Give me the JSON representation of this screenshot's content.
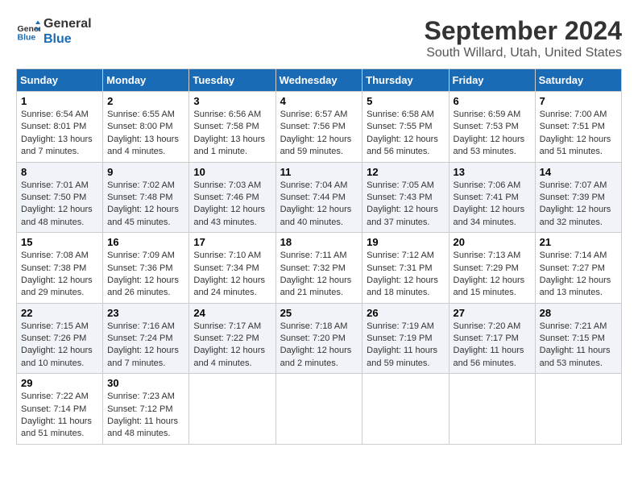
{
  "header": {
    "logo_line1": "General",
    "logo_line2": "Blue",
    "month": "September 2024",
    "location": "South Willard, Utah, United States"
  },
  "weekdays": [
    "Sunday",
    "Monday",
    "Tuesday",
    "Wednesday",
    "Thursday",
    "Friday",
    "Saturday"
  ],
  "weeks": [
    [
      {
        "day": "1",
        "info": "Sunrise: 6:54 AM\nSunset: 8:01 PM\nDaylight: 13 hours\nand 7 minutes."
      },
      {
        "day": "2",
        "info": "Sunrise: 6:55 AM\nSunset: 8:00 PM\nDaylight: 13 hours\nand 4 minutes."
      },
      {
        "day": "3",
        "info": "Sunrise: 6:56 AM\nSunset: 7:58 PM\nDaylight: 13 hours\nand 1 minute."
      },
      {
        "day": "4",
        "info": "Sunrise: 6:57 AM\nSunset: 7:56 PM\nDaylight: 12 hours\nand 59 minutes."
      },
      {
        "day": "5",
        "info": "Sunrise: 6:58 AM\nSunset: 7:55 PM\nDaylight: 12 hours\nand 56 minutes."
      },
      {
        "day": "6",
        "info": "Sunrise: 6:59 AM\nSunset: 7:53 PM\nDaylight: 12 hours\nand 53 minutes."
      },
      {
        "day": "7",
        "info": "Sunrise: 7:00 AM\nSunset: 7:51 PM\nDaylight: 12 hours\nand 51 minutes."
      }
    ],
    [
      {
        "day": "8",
        "info": "Sunrise: 7:01 AM\nSunset: 7:50 PM\nDaylight: 12 hours\nand 48 minutes."
      },
      {
        "day": "9",
        "info": "Sunrise: 7:02 AM\nSunset: 7:48 PM\nDaylight: 12 hours\nand 45 minutes."
      },
      {
        "day": "10",
        "info": "Sunrise: 7:03 AM\nSunset: 7:46 PM\nDaylight: 12 hours\nand 43 minutes."
      },
      {
        "day": "11",
        "info": "Sunrise: 7:04 AM\nSunset: 7:44 PM\nDaylight: 12 hours\nand 40 minutes."
      },
      {
        "day": "12",
        "info": "Sunrise: 7:05 AM\nSunset: 7:43 PM\nDaylight: 12 hours\nand 37 minutes."
      },
      {
        "day": "13",
        "info": "Sunrise: 7:06 AM\nSunset: 7:41 PM\nDaylight: 12 hours\nand 34 minutes."
      },
      {
        "day": "14",
        "info": "Sunrise: 7:07 AM\nSunset: 7:39 PM\nDaylight: 12 hours\nand 32 minutes."
      }
    ],
    [
      {
        "day": "15",
        "info": "Sunrise: 7:08 AM\nSunset: 7:38 PM\nDaylight: 12 hours\nand 29 minutes."
      },
      {
        "day": "16",
        "info": "Sunrise: 7:09 AM\nSunset: 7:36 PM\nDaylight: 12 hours\nand 26 minutes."
      },
      {
        "day": "17",
        "info": "Sunrise: 7:10 AM\nSunset: 7:34 PM\nDaylight: 12 hours\nand 24 minutes."
      },
      {
        "day": "18",
        "info": "Sunrise: 7:11 AM\nSunset: 7:32 PM\nDaylight: 12 hours\nand 21 minutes."
      },
      {
        "day": "19",
        "info": "Sunrise: 7:12 AM\nSunset: 7:31 PM\nDaylight: 12 hours\nand 18 minutes."
      },
      {
        "day": "20",
        "info": "Sunrise: 7:13 AM\nSunset: 7:29 PM\nDaylight: 12 hours\nand 15 minutes."
      },
      {
        "day": "21",
        "info": "Sunrise: 7:14 AM\nSunset: 7:27 PM\nDaylight: 12 hours\nand 13 minutes."
      }
    ],
    [
      {
        "day": "22",
        "info": "Sunrise: 7:15 AM\nSunset: 7:26 PM\nDaylight: 12 hours\nand 10 minutes."
      },
      {
        "day": "23",
        "info": "Sunrise: 7:16 AM\nSunset: 7:24 PM\nDaylight: 12 hours\nand 7 minutes."
      },
      {
        "day": "24",
        "info": "Sunrise: 7:17 AM\nSunset: 7:22 PM\nDaylight: 12 hours\nand 4 minutes."
      },
      {
        "day": "25",
        "info": "Sunrise: 7:18 AM\nSunset: 7:20 PM\nDaylight: 12 hours\nand 2 minutes."
      },
      {
        "day": "26",
        "info": "Sunrise: 7:19 AM\nSunset: 7:19 PM\nDaylight: 11 hours\nand 59 minutes."
      },
      {
        "day": "27",
        "info": "Sunrise: 7:20 AM\nSunset: 7:17 PM\nDaylight: 11 hours\nand 56 minutes."
      },
      {
        "day": "28",
        "info": "Sunrise: 7:21 AM\nSunset: 7:15 PM\nDaylight: 11 hours\nand 53 minutes."
      }
    ],
    [
      {
        "day": "29",
        "info": "Sunrise: 7:22 AM\nSunset: 7:14 PM\nDaylight: 11 hours\nand 51 minutes."
      },
      {
        "day": "30",
        "info": "Sunrise: 7:23 AM\nSunset: 7:12 PM\nDaylight: 11 hours\nand 48 minutes."
      },
      {
        "day": "",
        "info": ""
      },
      {
        "day": "",
        "info": ""
      },
      {
        "day": "",
        "info": ""
      },
      {
        "day": "",
        "info": ""
      },
      {
        "day": "",
        "info": ""
      }
    ]
  ]
}
